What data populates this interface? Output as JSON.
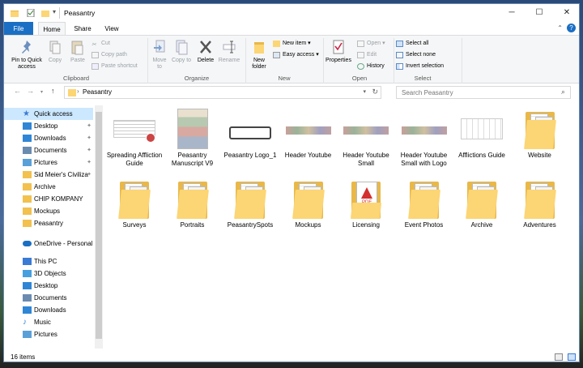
{
  "window": {
    "title": "Peasantry"
  },
  "ribbon_tabs": [
    "File",
    "Home",
    "Share",
    "View"
  ],
  "ribbon": {
    "clipboard": {
      "pin_label": "Pin to Quick access",
      "copy": "Copy",
      "paste": "Paste",
      "cut": "Cut",
      "copy_path": "Copy path",
      "paste_shortcut": "Paste shortcut",
      "group": "Clipboard"
    },
    "organize": {
      "move_to": "Move to",
      "copy_to": "Copy to",
      "delete": "Delete",
      "rename": "Rename",
      "group": "Organize"
    },
    "new": {
      "new_folder": "New folder",
      "new_item": "New item",
      "easy_access": "Easy access",
      "group": "New"
    },
    "open": {
      "properties": "Properties",
      "open": "Open",
      "edit": "Edit",
      "history": "History",
      "group": "Open"
    },
    "select": {
      "select_all": "Select all",
      "select_none": "Select none",
      "invert": "Invert selection",
      "group": "Select"
    }
  },
  "address": {
    "path": "Peasantry",
    "search_placeholder": "Search Peasantry"
  },
  "nav_items": [
    {
      "label": "Quick access",
      "icon": "star-icon",
      "selected": true
    },
    {
      "label": "Desktop",
      "icon": "desktop-icon",
      "pinned": true
    },
    {
      "label": "Downloads",
      "icon": "download-icon",
      "pinned": true
    },
    {
      "label": "Documents",
      "icon": "documents-icon",
      "pinned": true
    },
    {
      "label": "Pictures",
      "icon": "pictures-icon",
      "pinned": true
    },
    {
      "label": "Sid Meier's Civiliza",
      "icon": "folder-icon",
      "pinned": true
    },
    {
      "label": "Archive",
      "icon": "folder-icon"
    },
    {
      "label": "CHIP KOMPANY",
      "icon": "folder-icon"
    },
    {
      "label": "Mockups",
      "icon": "folder-icon"
    },
    {
      "label": "Peasantry",
      "icon": "folder-icon"
    },
    {
      "label": "OneDrive - Personal",
      "icon": "cloud-icon"
    },
    {
      "label": "This PC",
      "icon": "computer-icon"
    },
    {
      "label": "3D Objects",
      "icon": "3d-objects-icon"
    },
    {
      "label": "Desktop",
      "icon": "desktop-icon"
    },
    {
      "label": "Documents",
      "icon": "documents-icon"
    },
    {
      "label": "Downloads",
      "icon": "download-icon"
    },
    {
      "label": "Music",
      "icon": "music-icon"
    },
    {
      "label": "Pictures",
      "icon": "pictures-icon"
    }
  ],
  "files": [
    {
      "label": "Spreading Affliction Guide",
      "kind": "document"
    },
    {
      "label": "Peasantry Manuscript V9",
      "kind": "cover"
    },
    {
      "label": "Peasantry Logo_1",
      "kind": "logo"
    },
    {
      "label": "Header Youtube",
      "kind": "strip"
    },
    {
      "label": "Header Youtube Small",
      "kind": "strip"
    },
    {
      "label": "Header Youtube Small with Logo",
      "kind": "strip"
    },
    {
      "label": "Afflictions Guide",
      "kind": "sketch"
    },
    {
      "label": "Website",
      "kind": "folder"
    },
    {
      "label": "Surveys",
      "kind": "folder"
    },
    {
      "label": "Portraits",
      "kind": "folder"
    },
    {
      "label": "PeasantrySpots",
      "kind": "folder"
    },
    {
      "label": "Mockups",
      "kind": "folder"
    },
    {
      "label": "Licensing",
      "kind": "folder-pdf"
    },
    {
      "label": "Event Photos",
      "kind": "folder"
    },
    {
      "label": "Archive",
      "kind": "folder"
    },
    {
      "label": "Adventures",
      "kind": "folder"
    }
  ],
  "status": {
    "count": "16 items"
  }
}
